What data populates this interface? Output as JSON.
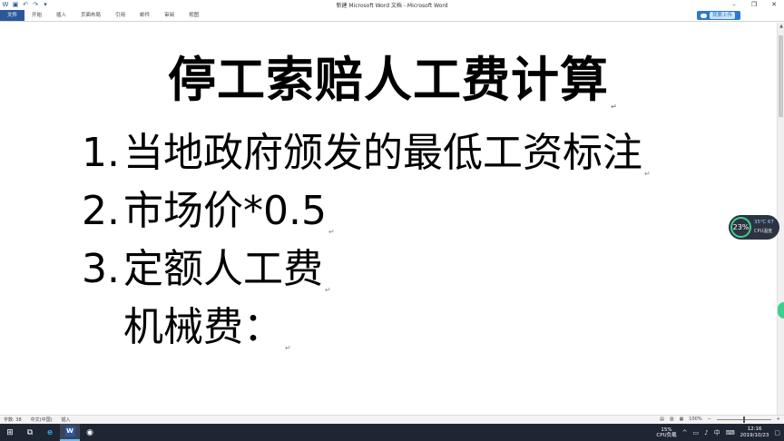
{
  "window": {
    "title": "新建 Microsoft Word 文档 - Microsoft Word"
  },
  "ribbon": {
    "tabs": [
      "文件",
      "开始",
      "插入",
      "页面布局",
      "引用",
      "邮件",
      "审阅",
      "视图"
    ],
    "share_label": "我要上传"
  },
  "document": {
    "title": "停工索赔人工费计算",
    "items": [
      {
        "num": "1.",
        "text": "当地政府颁发的最低工资标注"
      },
      {
        "num": "2.",
        "text": "市场价*0.5"
      },
      {
        "num": "3.",
        "text": "定额人工费"
      },
      {
        "num": "",
        "text": "机械费："
      }
    ]
  },
  "temp_widget": {
    "percent": "23%",
    "temperature": "35℃ 67",
    "label": "CPU温度"
  },
  "statusbar": {
    "word_count": "字数: 38",
    "language": "中文(中国)",
    "mode": "插入",
    "zoom": "100%"
  },
  "taskbar": {
    "cpu_percent": "15%",
    "cpu_label": "CPU负载",
    "ime": "中",
    "time": "12:16",
    "date": "2019/10/23"
  },
  "icons": {
    "word": "word-icon",
    "save": "save-icon",
    "undo": "undo-icon",
    "edge": "edge-icon"
  }
}
